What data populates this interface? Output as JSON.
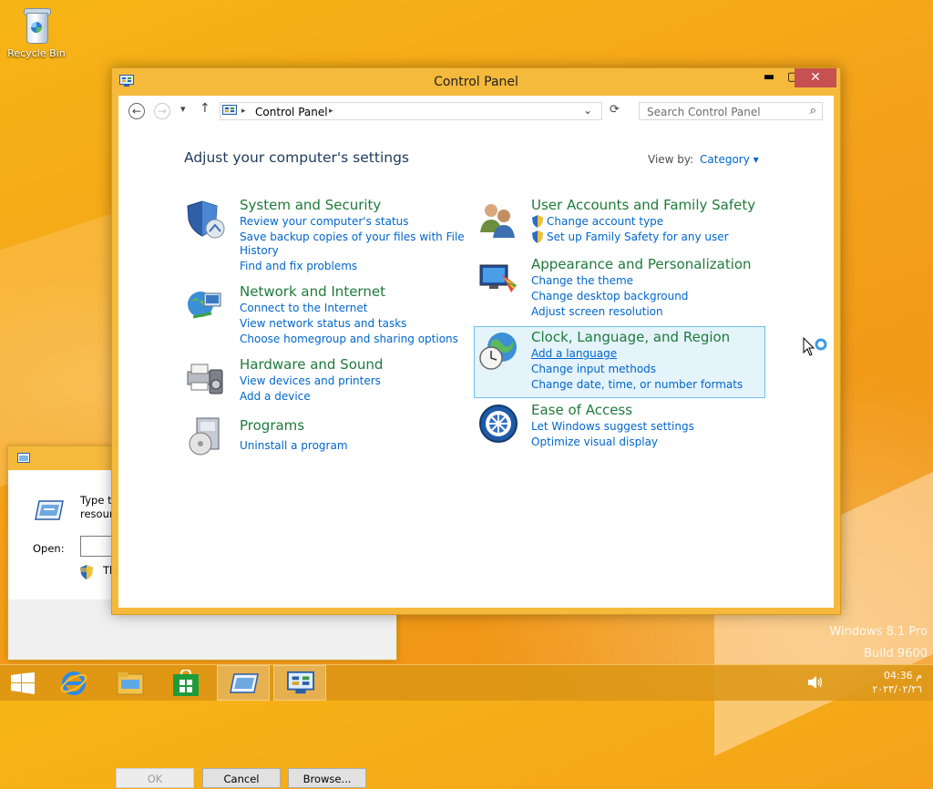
{
  "desktop": {
    "recycle_bin_label": "Recycle Bin",
    "watermark_line1": "Windows 8.1 Pro",
    "watermark_line2": "Build 9600"
  },
  "run_dialog": {
    "description_line1": "Type the",
    "description_line2": "resource",
    "open_label": "Open:",
    "note": "Thi",
    "ok_label": "OK",
    "cancel_label": "Cancel",
    "browse_label": "Browse..."
  },
  "window": {
    "title": "Control Panel",
    "minimize": "▬",
    "maximize": "▢",
    "close": "✕"
  },
  "toolbar": {
    "back": "←",
    "forward": "→",
    "recent": "▾",
    "up": "↑",
    "address": "Control Panel",
    "address_arrow_right": "▸",
    "address_dropdown": "⌄",
    "refresh": "⟳",
    "search_placeholder": "Search Control Panel",
    "search_icon": "⌕"
  },
  "main": {
    "heading": "Adjust your computer's settings",
    "view_by_label": "View by:",
    "view_by_value": "Category ▾",
    "categories": [
      {
        "title": "System and Security",
        "links": [
          "Review your computer's status",
          "Save backup copies of your files with File",
          "History",
          "Find and fix problems"
        ]
      },
      {
        "title": "Network and Internet",
        "links": [
          "Connect to the Internet",
          "View network status and tasks",
          "Choose homegroup and sharing options"
        ]
      },
      {
        "title": "Hardware and Sound",
        "links": [
          "View devices and printers",
          "Add a device"
        ]
      },
      {
        "title": "Programs",
        "links": [
          "Uninstall a program"
        ]
      },
      {
        "title": "User Accounts and Family Safety",
        "links": [
          "Change account type",
          "Set up Family Safety for any user"
        ]
      },
      {
        "title": "Appearance and Personalization",
        "links": [
          "Change the theme",
          "Change desktop background",
          "Adjust screen resolution"
        ]
      },
      {
        "title": "Clock, Language, and Region",
        "links": [
          "Add a language",
          "Change input methods",
          "Change date, time, or number formats"
        ]
      },
      {
        "title": "Ease of Access",
        "links": [
          "Let Windows suggest settings",
          "Optimize visual display"
        ]
      }
    ]
  },
  "taskbar": {
    "time": "04:36 م",
    "date": "٢٠٢٣/٠٢/٢٦",
    "icons": [
      "windows-icon",
      "internet-explorer-icon",
      "file-explorer-icon",
      "store-icon",
      "run-icon",
      "control-panel-icon"
    ]
  },
  "colors": {
    "window_frame": "#f5ba3c",
    "link": "#0066cc",
    "category_title": "#1e7a3a",
    "close_button": "#c75050",
    "selected_background": "#e5f3fb"
  }
}
